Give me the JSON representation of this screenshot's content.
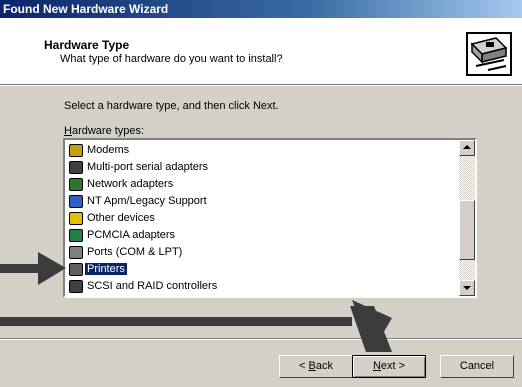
{
  "window": {
    "title": "Found New Hardware Wizard"
  },
  "header": {
    "title": "Hardware Type",
    "subtitle": "What type of hardware do you want to install?",
    "icon": "hardware-card-icon"
  },
  "body": {
    "prompt": "Select a hardware type, and then click Next.",
    "list_label_accel": "H",
    "list_label_rest": "ardware types:"
  },
  "hardware_types": [
    {
      "label": "Modems",
      "icon": "modem-icon",
      "color": "#c8a000",
      "selected": false
    },
    {
      "label": "Multi-port serial adapters",
      "icon": "serial-port-icon",
      "color": "#404040",
      "selected": false
    },
    {
      "label": "Network adapters",
      "icon": "network-adapter-icon",
      "color": "#2a7a2a",
      "selected": false
    },
    {
      "label": "NT Apm/Legacy Support",
      "icon": "computer-icon",
      "color": "#3060c0",
      "selected": false
    },
    {
      "label": "Other devices",
      "icon": "question-icon",
      "color": "#e0c000",
      "selected": false
    },
    {
      "label": "PCMCIA adapters",
      "icon": "pcmcia-icon",
      "color": "#208040",
      "selected": false
    },
    {
      "label": "Ports (COM & LPT)",
      "icon": "port-icon",
      "color": "#808080",
      "selected": false
    },
    {
      "label": "Printers",
      "icon": "printer-icon",
      "color": "#606060",
      "selected": true
    },
    {
      "label": "SCSI and RAID controllers",
      "icon": "scsi-icon",
      "color": "#404040",
      "selected": false
    }
  ],
  "buttons": {
    "back_accel": "B",
    "back_pre": "< ",
    "back_rest": "ack",
    "next_accel": "N",
    "next_rest": "ext >",
    "cancel": "Cancel"
  },
  "colors": {
    "selection": "#0a246a",
    "face": "#d4d0c8",
    "annotation_arrow": "#3c3c3c"
  }
}
